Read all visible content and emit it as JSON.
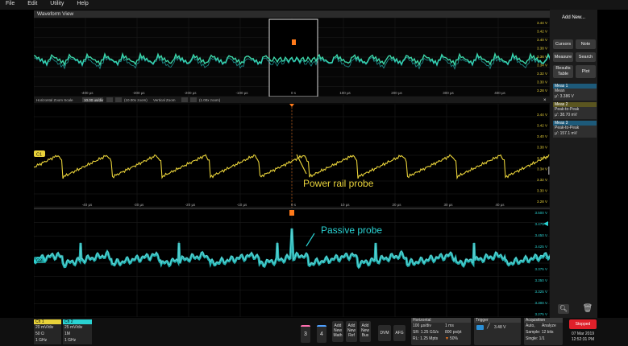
{
  "menu": [
    "File",
    "Edit",
    "Utility",
    "Help"
  ],
  "waveform_view": {
    "title": "Waveform View"
  },
  "overview": {
    "x_ticks": [
      "-400 µs",
      "-300 µs",
      "-200 µs",
      "-100 µs",
      "0 s",
      "100 µs",
      "200 µs",
      "300 µs",
      "400 µs"
    ],
    "y_ticks": [
      "3.44 V",
      "3.42 V",
      "3.40 V",
      "3.38 V",
      "3.36 V",
      "3.34 V",
      "3.32 V",
      "3.30 V",
      "3.28 V"
    ],
    "zoom_bar": {
      "horizontal_label": "Horizontal Zoom Scale",
      "horizontal_value": "10.00 us/div",
      "horizontal_factor": "(10.00x zoom)",
      "vertical_label": "Vertical Zoom",
      "vertical_factor": "(1.00x zoom)"
    }
  },
  "ch1_plot": {
    "label": "Power rail probe",
    "marker": "C1",
    "x_ticks": [
      "-40 µs",
      "-30 µs",
      "-20 µs",
      "-10 µs",
      "0 s",
      "10 µs",
      "20 µs",
      "30 µs",
      "40 µs"
    ],
    "y_ticks": [
      "3.44 V",
      "3.42 V",
      "3.40 V",
      "3.38 V",
      "3.36 V",
      "3.34 V",
      "3.32 V",
      "3.30 V",
      "3.28 V"
    ]
  },
  "ch2_plot": {
    "label": "Passive probe",
    "marker": "C2",
    "y_ticks": [
      "3.500 V",
      "3.475 V",
      "3.450 V",
      "3.425 V",
      "3.400 V",
      "3.375 V",
      "3.350 V",
      "3.325 V",
      "3.300 V",
      "3.275 V"
    ]
  },
  "sidebar": {
    "add_new": "Add New...",
    "buttons": [
      "Cursors",
      "Note",
      "Measure",
      "Search",
      "Results Table",
      "Plot"
    ],
    "measurements": [
      {
        "title": "Meas 1",
        "name": "Mean",
        "value": "µ': 3.386 V"
      },
      {
        "title": "Meas 2",
        "name": "Peak-to-Peak",
        "value": "µ': 38.70 mV"
      },
      {
        "title": "Meas 3",
        "name": "Peak-to-Peak",
        "value": "µ': 157.1 mV"
      }
    ]
  },
  "bottom": {
    "ch1": {
      "title": "Ch 1",
      "line1": "20 mV/div",
      "line2": "50 Ω",
      "line3": "1 GHz"
    },
    "ch2": {
      "title": "Ch 2",
      "line1": "25 mV/div",
      "line2": "1M",
      "line3": "1 GHz"
    },
    "num3": "3",
    "num4": "4",
    "add_math": "Add New Math",
    "add_ref": "Add New Ref",
    "add_bus": "Add New Bus",
    "dvm": "DVM",
    "afg": "AFG",
    "horizontal": {
      "title": "Horizontal",
      "l1a": "100 µs/div",
      "l1b": "1 ms",
      "l2a": "SR: 1.25 GS/s",
      "l2b": "800 ps/pt",
      "l3a": "RL: 1.25 Mpts",
      "l3b": "50%"
    },
    "trigger": {
      "title": "Trigger",
      "value": "3.48 V"
    },
    "acquisition": {
      "title": "Acquisition",
      "l1a": "Auto,",
      "l1b": "Analyze",
      "l2": "Sample: 12 bits",
      "l3": "Single: 1/1"
    },
    "stopped": "Stopped",
    "date": "07 Mar 2019",
    "time": "12:52:31 PM"
  },
  "colors": {
    "ch1": "#e8d23a",
    "ch2": "#2ad2d2",
    "overview": "#3dd6a8",
    "stopped": "#e0202a",
    "cursor": "#ff7a1a"
  }
}
